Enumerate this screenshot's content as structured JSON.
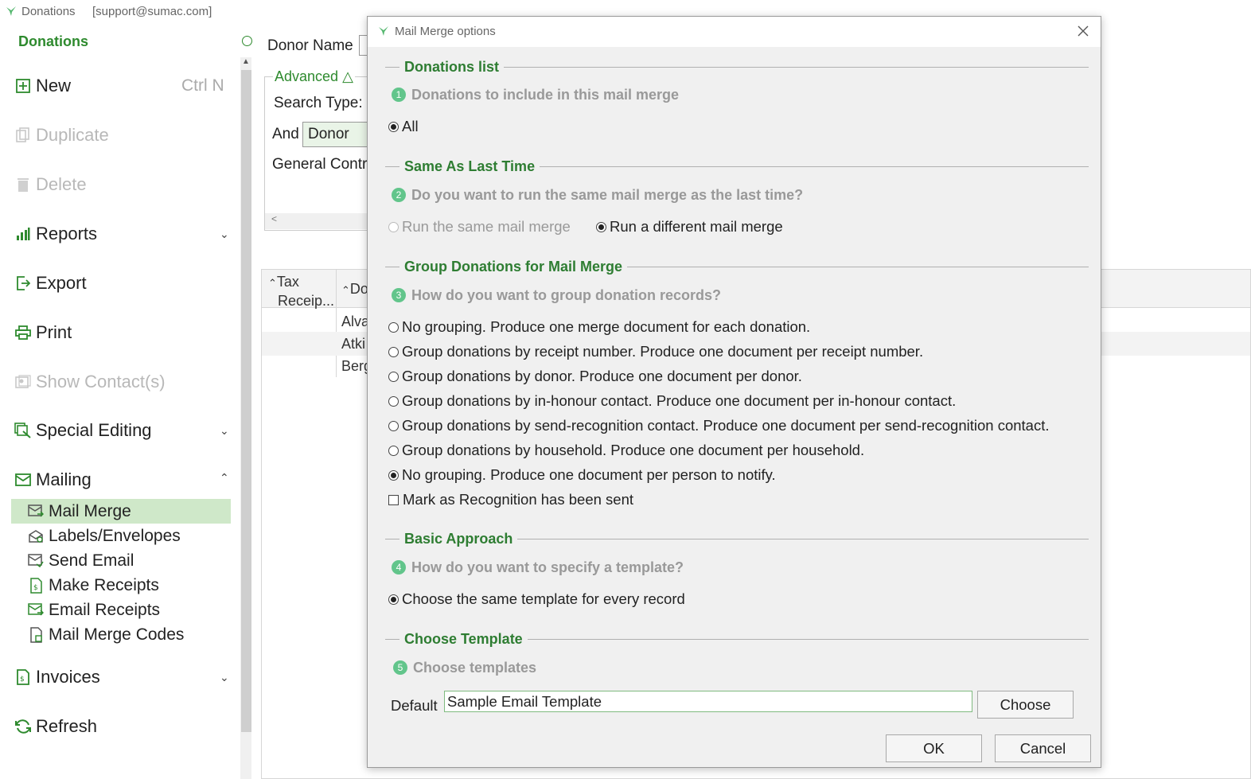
{
  "window": {
    "app_name": "Donations",
    "user": "[support@sumac.com]"
  },
  "sidebar": {
    "heading": "Donations",
    "items": [
      {
        "label": "New",
        "shortcut": "Ctrl N"
      },
      {
        "label": "Duplicate"
      },
      {
        "label": "Delete"
      },
      {
        "label": "Reports"
      },
      {
        "label": "Export"
      },
      {
        "label": "Print"
      },
      {
        "label": "Show Contact(s)"
      },
      {
        "label": "Special Editing"
      },
      {
        "label": "Mailing"
      },
      {
        "label": "Invoices"
      },
      {
        "label": "Refresh"
      }
    ],
    "mailing_items": [
      {
        "label": "Mail Merge"
      },
      {
        "label": "Labels/Envelopes"
      },
      {
        "label": "Send Email"
      },
      {
        "label": "Make Receipts"
      },
      {
        "label": "Email Receipts"
      },
      {
        "label": "Mail Merge Codes"
      }
    ]
  },
  "background": {
    "donor_name_label": "Donor Name",
    "advanced_label": "Advanced",
    "search_type_label": "Search Type:",
    "and_label": "And",
    "and_value": "Donor",
    "general_contr_label": "General Contr",
    "columns": {
      "tax_line1": "Tax",
      "tax_line2": "Receip...",
      "donor_short": "Do"
    },
    "rows": [
      "Alva",
      "Atki",
      "Berg"
    ]
  },
  "dialog": {
    "title": "Mail Merge options",
    "sections": {
      "donations_list": "Donations list",
      "same_as_last_time": "Same As Last Time",
      "group_donations": "Group Donations for Mail Merge",
      "basic_approach": "Basic Approach",
      "choose_template": "Choose Template"
    },
    "questions": [
      {
        "num": "1",
        "text": "Donations to include in this mail merge"
      },
      {
        "num": "2",
        "text": "Do you want to run the same mail merge as the last time?"
      },
      {
        "num": "3",
        "text": "How do you want to group donation records?"
      },
      {
        "num": "4",
        "text": "How do you want to specify a template?"
      },
      {
        "num": "5",
        "text": "Choose templates"
      }
    ],
    "include_all": "All",
    "run_same": "Run the same mail merge",
    "run_different": "Run a different mail merge",
    "grouping_options": [
      "No grouping. Produce one merge document for each donation.",
      "Group donations by receipt number. Produce one document per receipt number.",
      "Group donations by donor. Produce one document per donor.",
      "Group donations by in-honour contact. Produce one document per in-honour contact.",
      "Group donations by send-recognition contact. Produce one document per send-recognition contact.",
      "Group donations by household. Produce one document per household.",
      "No grouping. Produce one document per person to notify."
    ],
    "selected_grouping": "No grouping. Produce one document per person to notify.",
    "mark_recognition_label": "Mark as Recognition has been sent",
    "template_approach": "Choose the same template for every record",
    "default_label": "Default",
    "default_template_value": "Sample Email Template",
    "choose_button": "Choose",
    "ok_button": "OK",
    "cancel_button": "Cancel"
  },
  "colors": {
    "brand_green": "#2e8a2e",
    "selected_bg": "#cfe8c9",
    "question_badge": "#62c58b"
  }
}
